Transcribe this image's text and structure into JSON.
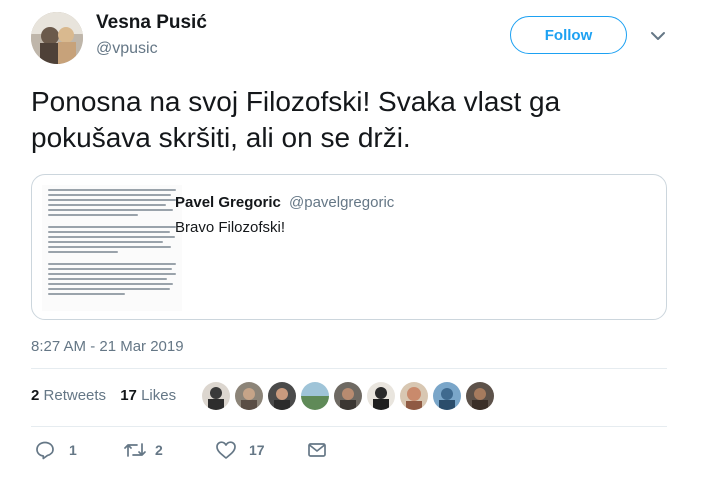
{
  "author": {
    "name": "Vesna Pusić",
    "handle": "@vpusic"
  },
  "follow_label": "Follow",
  "tweet": {
    "text": "Ponosna na svoj Filozofski! Svaka vlast ga pokušava skršiti, ali on se drži."
  },
  "quoted": {
    "name": "Pavel Gregoric",
    "handle": "@pavelgregoric",
    "text": "Bravo Filozofski!"
  },
  "timestamp": "8:27 AM - 21 Mar 2019",
  "stats": {
    "retweets_count": "2",
    "retweets_label": "Retweets",
    "likes_count": "17",
    "likes_label": "Likes"
  },
  "actions": {
    "reply_count": "1",
    "retweet_count": "2",
    "like_count": "17"
  },
  "colors": {
    "accent": "#1da1f2",
    "muted": "#657786",
    "text": "#14171a",
    "border": "#ccd6dd"
  },
  "icons": [
    "chevron-down-icon",
    "reply-icon",
    "retweet-icon",
    "heart-icon",
    "message-icon"
  ]
}
